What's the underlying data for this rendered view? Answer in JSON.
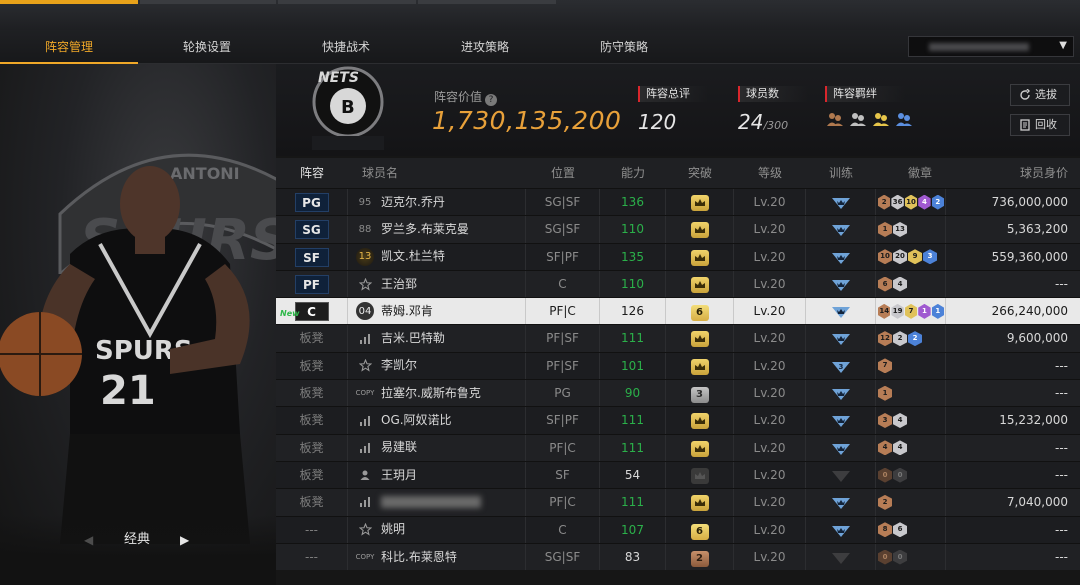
{
  "nav": {
    "tabs": [
      "阵容管理",
      "轮换设置",
      "快捷战术",
      "进攻策略",
      "防守策略"
    ],
    "active_tab": 0
  },
  "left": {
    "card_label": "经典"
  },
  "header": {
    "value_label": "阵容价值",
    "value": "1,730,135,200",
    "overall_label": "阵容总评",
    "overall": "120",
    "count_label": "球员数",
    "count": "24",
    "count_max": "/300",
    "bond_label": "阵容羁绊",
    "btn_select": "选拔",
    "btn_recycle": "回收"
  },
  "table": {
    "headers": [
      "阵容",
      "球员名",
      "位置",
      "能力",
      "突破",
      "等级",
      "训练",
      "徽章",
      "球员身价"
    ],
    "rows": [
      {
        "slot": "PG",
        "icon": "95",
        "icon_type": "num",
        "name": "迈克尔.乔丹",
        "pos": "SG|SF",
        "ability": "136",
        "green": true,
        "brk": "",
        "brk_type": "gold",
        "level": "Lv.20",
        "train": "blue",
        "badges": [
          [
            "2",
            "bronze"
          ],
          [
            "36",
            "silver"
          ],
          [
            "10",
            "gold"
          ],
          [
            "4",
            "purple"
          ],
          [
            "2",
            "blue"
          ]
        ],
        "price": "736,000,000"
      },
      {
        "slot": "SG",
        "icon": "88",
        "icon_type": "num",
        "name": "罗兰多.布莱克曼",
        "pos": "SG|SF",
        "ability": "110",
        "green": true,
        "brk": "",
        "brk_type": "gold",
        "level": "Lv.20",
        "train": "blue",
        "badges": [
          [
            "1",
            "bronze"
          ],
          [
            "13",
            "silver"
          ]
        ],
        "price": "5,363,200"
      },
      {
        "slot": "SF",
        "icon": "13",
        "icon_type": "gold",
        "name": "凯文.杜兰特",
        "pos": "SF|PF",
        "ability": "135",
        "green": true,
        "brk": "",
        "brk_type": "gold",
        "level": "Lv.20",
        "train": "blue",
        "badges": [
          [
            "10",
            "bronze"
          ],
          [
            "20",
            "silver"
          ],
          [
            "9",
            "gold"
          ],
          [
            "3",
            "blue"
          ]
        ],
        "price": "559,360,000"
      },
      {
        "slot": "PF",
        "icon": "star",
        "icon_type": "star",
        "name": "王治郅",
        "pos": "C",
        "ability": "110",
        "green": true,
        "brk": "",
        "brk_type": "gold",
        "level": "Lv.20",
        "train": "blue",
        "badges": [
          [
            "6",
            "bronze"
          ],
          [
            "4",
            "silver"
          ]
        ],
        "price": "---"
      },
      {
        "slot": "C",
        "icon": "04",
        "icon_type": "dark",
        "name": "蒂姆.邓肯",
        "pos": "PF|C",
        "ability": "126",
        "green": false,
        "brk": "6",
        "brk_type": "goldnum",
        "level": "Lv.20",
        "train": "blue",
        "badges": [
          [
            "14",
            "bronze"
          ],
          [
            "19",
            "silver"
          ],
          [
            "7",
            "gold"
          ],
          [
            "1",
            "purple"
          ],
          [
            "1",
            "blue"
          ]
        ],
        "price": "266,240,000",
        "selected": true,
        "new": "New"
      },
      {
        "slot": "板凳",
        "icon": "bars",
        "icon_type": "bars",
        "name": "吉米.巴特勒",
        "pos": "PF|SF",
        "ability": "111",
        "green": true,
        "brk": "",
        "brk_type": "gold",
        "level": "Lv.20",
        "train": "blue",
        "badges": [
          [
            "12",
            "bronze"
          ],
          [
            "2",
            "silver"
          ],
          [
            "2",
            "blue"
          ]
        ],
        "price": "9,600,000"
      },
      {
        "slot": "板凳",
        "icon": "star",
        "icon_type": "star",
        "name": "李凯尔",
        "pos": "PF|SF",
        "ability": "101",
        "green": true,
        "brk": "",
        "brk_type": "gold",
        "level": "Lv.20",
        "train": "blue3",
        "badges": [
          [
            "7",
            "bronze"
          ]
        ],
        "price": "---"
      },
      {
        "slot": "板凳",
        "icon": "COPY",
        "icon_type": "copy",
        "name": "拉塞尔.威斯布鲁克",
        "pos": "PG",
        "ability": "90",
        "green": true,
        "brk": "3",
        "brk_type": "silver",
        "level": "Lv.20",
        "train": "blue",
        "badges": [
          [
            "1",
            "bronze"
          ]
        ],
        "price": "---"
      },
      {
        "slot": "板凳",
        "icon": "bars",
        "icon_type": "bars",
        "name": "OG.阿奴诺比",
        "pos": "SF|PF",
        "ability": "111",
        "green": true,
        "brk": "",
        "brk_type": "gold",
        "level": "Lv.20",
        "train": "blue",
        "badges": [
          [
            "3",
            "bronze"
          ],
          [
            "4",
            "silver"
          ]
        ],
        "price": "15,232,000"
      },
      {
        "slot": "板凳",
        "icon": "bars",
        "icon_type": "bars",
        "name": "易建联",
        "pos": "PF|C",
        "ability": "111",
        "green": true,
        "brk": "",
        "brk_type": "gold",
        "level": "Lv.20",
        "train": "blue",
        "badges": [
          [
            "4",
            "bronze"
          ],
          [
            "4",
            "silver"
          ]
        ],
        "price": "---"
      },
      {
        "slot": "板凳",
        "icon": "person",
        "icon_type": "person",
        "name": "王玥月",
        "pos": "SF",
        "ability": "54",
        "green": false,
        "brk": "",
        "brk_type": "gray",
        "level": "Lv.20",
        "train": "gray",
        "badges": [
          [
            "0",
            "dimb"
          ],
          [
            "0",
            "dim"
          ]
        ],
        "price": "---"
      },
      {
        "slot": "板凳",
        "icon": "bars",
        "icon_type": "bars",
        "name": "",
        "blurred": true,
        "pos": "PF|C",
        "ability": "111",
        "green": true,
        "brk": "",
        "brk_type": "gold",
        "level": "Lv.20",
        "train": "blue",
        "badges": [
          [
            "2",
            "bronze"
          ]
        ],
        "price": "7,040,000"
      },
      {
        "slot": "---",
        "icon": "star",
        "icon_type": "star",
        "name": "姚明",
        "pos": "C",
        "ability": "107",
        "green": true,
        "brk": "6",
        "brk_type": "goldnum",
        "level": "Lv.20",
        "train": "blue",
        "badges": [
          [
            "8",
            "bronze"
          ],
          [
            "6",
            "silver"
          ]
        ],
        "price": "---"
      },
      {
        "slot": "---",
        "icon": "COPY",
        "icon_type": "copy",
        "name": "科比.布莱恩特",
        "pos": "SG|SF",
        "ability": "83",
        "green": false,
        "brk": "2",
        "brk_type": "bronze",
        "level": "Lv.20",
        "train": "gray",
        "badges": [
          [
            "0",
            "dimb"
          ],
          [
            "0",
            "dim"
          ]
        ],
        "price": "---"
      }
    ]
  },
  "colors": {
    "accent": "#f0a828",
    "value": "#e8a13a",
    "green": "#2bb04a",
    "stat_mark": "#d9262c"
  }
}
